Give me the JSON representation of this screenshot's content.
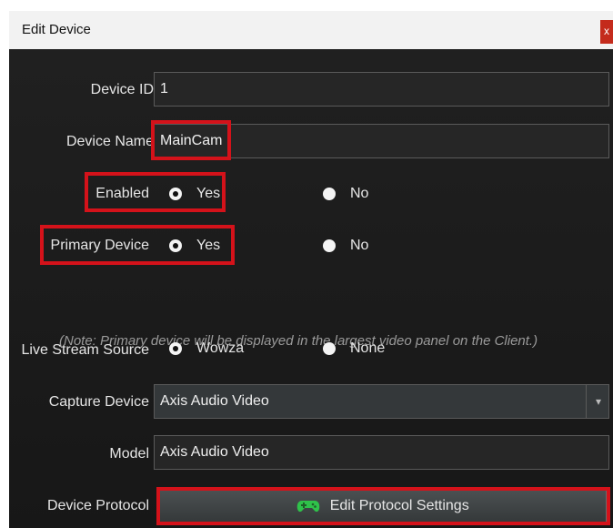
{
  "window": {
    "title": "Edit Device",
    "close_label": "x"
  },
  "form": {
    "device_id": {
      "label": "Device ID",
      "value": "1"
    },
    "device_name": {
      "label": "Device Name",
      "value": "MainCam"
    },
    "enabled": {
      "label": "Enabled",
      "yes": "Yes",
      "no": "No",
      "selected": "Yes"
    },
    "primary_device": {
      "label": "Primary Device",
      "yes": "Yes",
      "no": "No",
      "selected": "Yes"
    },
    "note": "(Note: Primary device will be displayed in the largest video panel on the Client.)",
    "live_stream_source": {
      "label": "Live Stream Source",
      "option1": "Wowza",
      "option2": "None",
      "selected": "Wowza"
    },
    "capture_device": {
      "label": "Capture Device",
      "value": "Axis Audio Video"
    },
    "model": {
      "label": "Model",
      "value": "Axis Audio Video"
    },
    "device_protocol": {
      "label": "Device Protocol",
      "button_label": "Edit Protocol Settings"
    }
  },
  "colors": {
    "highlight": "#d4121a",
    "gamepad_icon": "#2fc24a",
    "background": "#1b1b1b"
  },
  "icons": {
    "protocol_button": "gamepad-icon",
    "combo_arrow": "chevron-down-icon"
  }
}
